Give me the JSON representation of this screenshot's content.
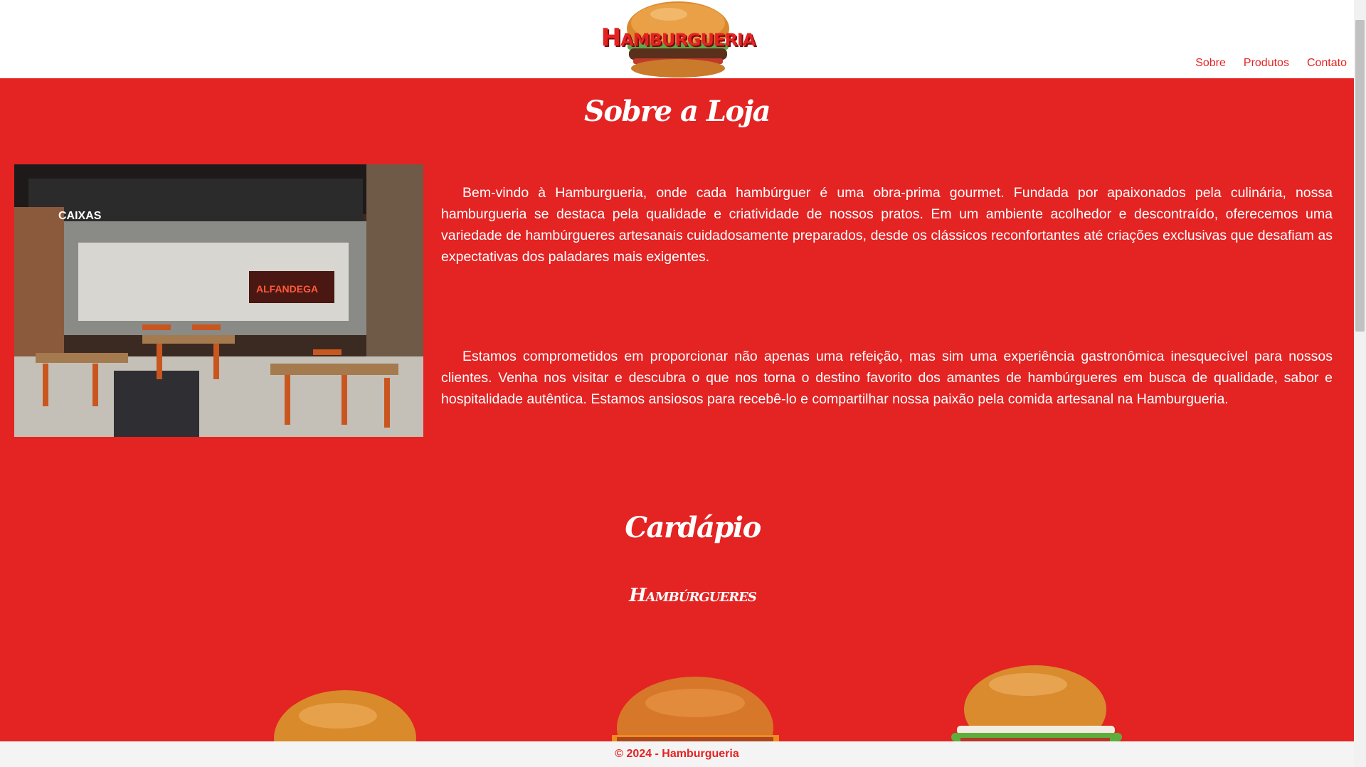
{
  "header": {
    "logo_text": "Hamburgueria",
    "nav": {
      "about": "Sobre",
      "products": "Produtos",
      "contact": "Contato"
    }
  },
  "about": {
    "title": "Sobre a Loja",
    "paragraph1": "Bem-vindo à Hamburgueria, onde cada hambúrguer é uma obra-prima gourmet. Fundada por apaixonados pela culinária, nossa hamburgueria se destaca pela qualidade e criatividade de nossos pratos. Em um ambiente acolhedor e descontraído, oferecemos uma variedade de hambúrgueres artesanais cuidadosamente preparados, desde os clássicos reconfortantes até criações exclusivas que desafiam as expectativas dos paladares mais exigentes.",
    "paragraph2": "Estamos comprometidos em proporcionar não apenas uma refeição, mas sim uma experiência gastronômica inesquecível para nossos clientes. Venha nos visitar e descubra o que nos torna o destino favorito dos amantes de hambúrgueres em busca de qualidade, sabor e hospitalidade autêntica. Estamos ansiosos para recebê-lo e compartilhar nossa paixão pela comida artesanal na Hamburgueria.",
    "photo_sign_caixas": "CAIXAS",
    "photo_sign_alfandega": "ALFANDEGA"
  },
  "menu": {
    "title": "Cardápio",
    "category": "Hambúrgueres"
  },
  "footer": {
    "text": "© 2024 - Hamburgueria"
  },
  "colors": {
    "brand_red": "#e42323",
    "header_bg": "#ffffff",
    "footer_bg": "#f4f4f4"
  }
}
